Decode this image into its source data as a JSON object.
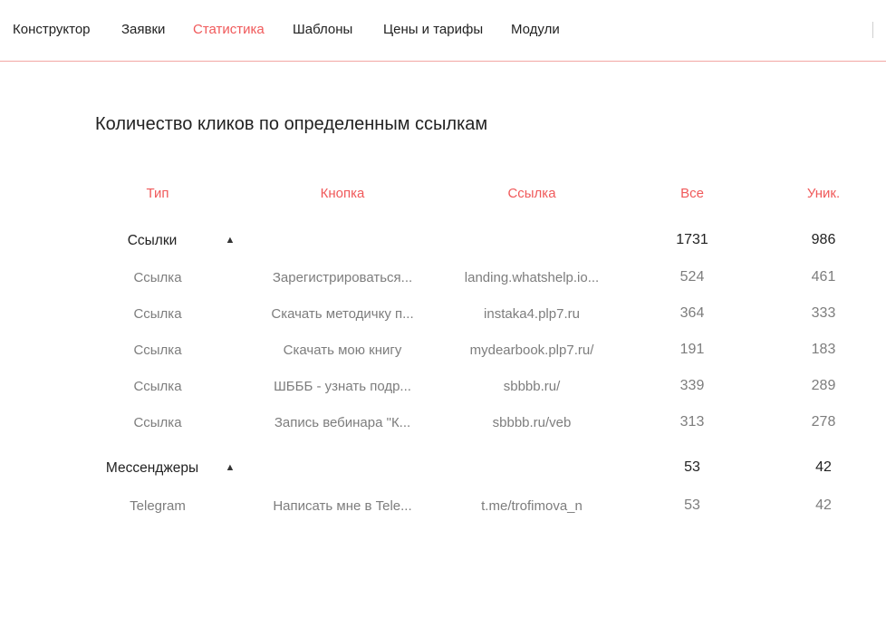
{
  "nav": {
    "items": [
      {
        "label": "Конструктор",
        "active": false
      },
      {
        "label": "Заявки",
        "active": false
      },
      {
        "label": "Статистика",
        "active": true
      },
      {
        "label": "Шаблоны",
        "active": false
      },
      {
        "label": "Цены и тарифы",
        "active": false
      },
      {
        "label": "Модули",
        "active": false
      }
    ]
  },
  "section_title": "Количество кликов по определенным ссылкам",
  "table": {
    "headers": {
      "type": "Тип",
      "button": "Кнопка",
      "link": "Ссылка",
      "all": "Все",
      "unique": "Уник."
    },
    "groups": [
      {
        "name": "Ссылки",
        "toggle_icon": "▲",
        "all": "1731",
        "unique": "986",
        "rows": [
          {
            "type": "Ссылка",
            "button": "Зарегистрироваться...",
            "link": "landing.whatshelp.io...",
            "all": "524",
            "unique": "461"
          },
          {
            "type": "Ссылка",
            "button": "Скачать методичку п...",
            "link": "instaka4.plp7.ru",
            "all": "364",
            "unique": "333"
          },
          {
            "type": "Ссылка",
            "button": "Скачать мою книгу",
            "link": "mydearbook.plp7.ru/",
            "all": "191",
            "unique": "183"
          },
          {
            "type": "Ссылка",
            "button": "ШБББ - узнать подр...",
            "link": "sbbbb.ru/",
            "all": "339",
            "unique": "289"
          },
          {
            "type": "Ссылка",
            "button": "Запись вебинара \"К...",
            "link": "sbbbb.ru/veb",
            "all": "313",
            "unique": "278"
          }
        ]
      },
      {
        "name": "Мессенджеры",
        "toggle_icon": "▲",
        "all": "53",
        "unique": "42",
        "rows": [
          {
            "type": "Telegram",
            "button": "Написать мне в Tele...",
            "link": "t.me/trofimova_n",
            "all": "53",
            "unique": "42"
          }
        ]
      }
    ]
  },
  "colors": {
    "accent": "#f0595a",
    "text_dark": "#222222",
    "text_muted": "#7d7d7d",
    "divider": "#f2a7a4"
  }
}
